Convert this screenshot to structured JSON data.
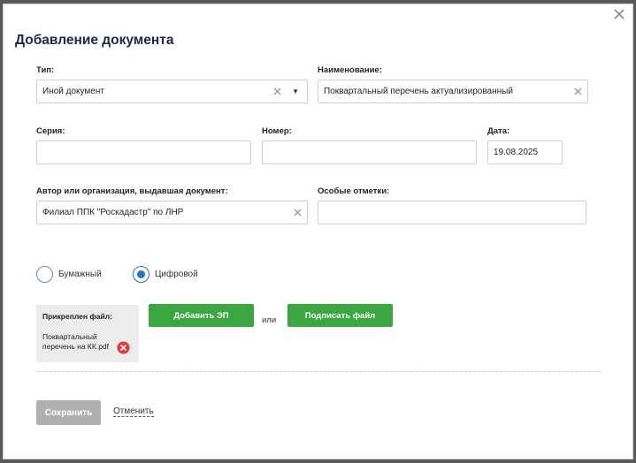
{
  "dialog": {
    "title": "Добавление документа",
    "close_icon": "close-icon"
  },
  "fields": {
    "type": {
      "label": "Тип:",
      "value": "Иной документ"
    },
    "name": {
      "label": "Наименование:",
      "value": "Поквартальный перечень актуализированный"
    },
    "series": {
      "label": "Серия:",
      "value": ""
    },
    "number": {
      "label": "Номер:",
      "value": ""
    },
    "date": {
      "label": "Дата:",
      "value": "19.08.2025"
    },
    "author": {
      "label": "Автор или организация, выдавшая документ:",
      "value": "Филиал ППК \"Роскадастр\" по ЛНР"
    },
    "notes": {
      "label": "Особые отметки:",
      "value": ""
    }
  },
  "format": {
    "options": [
      {
        "label": "Бумажный",
        "checked": false
      },
      {
        "label": "Цифровой",
        "checked": true
      }
    ]
  },
  "attachment": {
    "header": "Прикреплен файл:",
    "filename": "Поквартальный перечень на КК.pdf",
    "remove_icon": "remove-file-icon"
  },
  "actions": {
    "add_signature": "Добавить ЭП",
    "or": "или",
    "sign_file": "Подписать файл",
    "save": "Сохранить",
    "cancel": "Отменить"
  },
  "colors": {
    "green": "#3aa63f",
    "disabled": "#b0b0b0",
    "radio_checked": "#2476c1",
    "remove": "#e03a3a"
  }
}
